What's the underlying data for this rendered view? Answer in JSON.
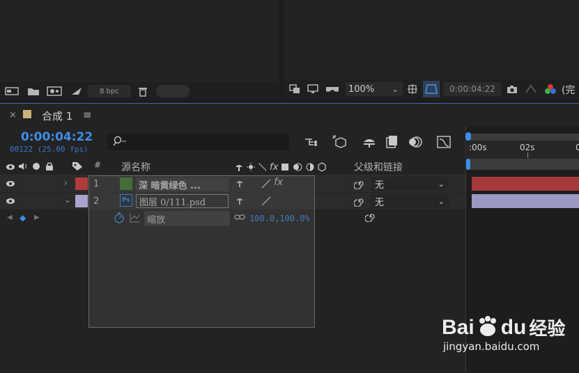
{
  "project": {
    "bpc_label": "8 bpc"
  },
  "viewer": {
    "zoom": "100%",
    "timecode": "0:00:04:22",
    "channel_label": "(完"
  },
  "timeline": {
    "tab_close": "×",
    "tab_title": "合成 1",
    "tab_menu": "≡",
    "current_time": "0:00:04:22",
    "frame_info": "00122 (25.00 fps)",
    "search_placeholder": "",
    "headers": {
      "number": "#",
      "source_name": "源名称",
      "parent": "父级和链接"
    },
    "ruler": {
      "start": ":00s",
      "mark": "02s",
      "end": "0"
    },
    "layers": [
      {
        "index": "1",
        "name": "深 暗黄绿色 ...",
        "color": "#b13a3a",
        "chip": "#3f7f2a",
        "parent": "无"
      },
      {
        "index": "2",
        "name": "图层 0/111.psd",
        "color": "#a9a4cf",
        "chip": "#1b2a3a",
        "parent": "无"
      }
    ],
    "property": {
      "name": "缩放",
      "value": "100.0,100.0%"
    }
  },
  "watermark": {
    "brand": "Bai",
    "brand2": "du",
    "cn": "经验",
    "url": "jingyan.baidu.com"
  }
}
